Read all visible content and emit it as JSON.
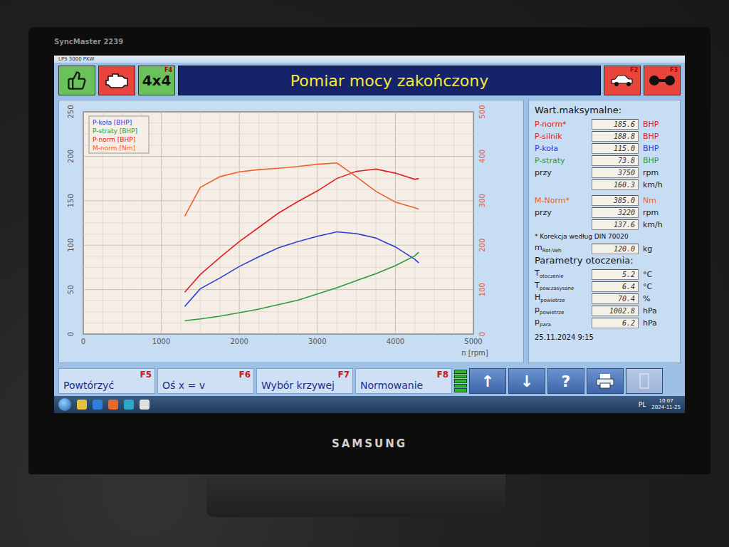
{
  "monitor": {
    "model": "SyncMaster 2239",
    "brand": "SAMSUNG"
  },
  "window": {
    "title": "LPS 3000 PKW"
  },
  "header": {
    "left_buttons": [
      {
        "kind": "thumbs",
        "color": "#6cc25a"
      },
      {
        "kind": "engine",
        "color": "#e8463c"
      },
      {
        "kind": "text",
        "label": "4x4",
        "key": "F4",
        "color": "#6cc25a"
      }
    ],
    "title": "Pomiar mocy zakończony",
    "right_buttons": [
      {
        "kind": "car",
        "key": "F2",
        "color": "#e8463c"
      },
      {
        "kind": "rollers",
        "key": "F3",
        "color": "#e8463c"
      }
    ]
  },
  "chart": {
    "y_left_ticks": [
      "0",
      "50",
      "100",
      "150",
      "200",
      "250"
    ],
    "y_right_ticks": [
      "0",
      "100",
      "200",
      "300",
      "400",
      "500"
    ],
    "x_ticks": [
      "0",
      "1000",
      "2000",
      "3000",
      "4000",
      "5000"
    ],
    "x_label": "n [rpm]",
    "rpm": [
      1300,
      1500,
      1750,
      2000,
      2250,
      2500,
      2750,
      3000,
      3250,
      3500,
      3750,
      4000,
      4250,
      4300
    ],
    "series": [
      {
        "name": "P-koła [BHP]",
        "axis": "left",
        "color": "#2a3fd0",
        "values": [
          31,
          51,
          63,
          76,
          87,
          97,
          104,
          110,
          115,
          113,
          108,
          98,
          84,
          80
        ]
      },
      {
        "name": "P-straty [BHP]",
        "axis": "left",
        "color": "#2a9a3a",
        "values": [
          15,
          17,
          20,
          24,
          28,
          33,
          38,
          45,
          52,
          60,
          68,
          77,
          88,
          92
        ]
      },
      {
        "name": "P-norm [BHP]",
        "axis": "left",
        "color": "#e02020",
        "values": [
          47,
          67,
          86,
          104,
          120,
          136,
          149,
          161,
          175,
          183,
          185.6,
          181,
          174,
          175
        ]
      },
      {
        "name": "M-norm [Nm]",
        "axis": "right",
        "color": "#f0602a",
        "values": [
          265,
          330,
          354,
          365,
          370,
          373,
          377,
          382,
          385,
          354,
          321,
          297,
          284,
          281
        ]
      }
    ]
  },
  "max_values": {
    "title": "Wart.maksymalne:",
    "rows": [
      {
        "label": "P-norm*",
        "value": "185.6",
        "unit": "BHP",
        "color": "#e02020"
      },
      {
        "label": "P-silnik",
        "value": "188.8",
        "unit": "BHP",
        "color": "#e02020"
      },
      {
        "label": "P-koła",
        "value": "115.0",
        "unit": "BHP",
        "color": "#2a3fd0"
      },
      {
        "label": "P-straty",
        "value": "73.8",
        "unit": "BHP",
        "color": "#2a9a3a"
      },
      {
        "label": "przy",
        "value": "3750",
        "unit": "rpm",
        "color": "#1a1a1a"
      },
      {
        "label": "",
        "value": "160.3",
        "unit": "km/h",
        "color": "#1a1a1a"
      }
    ],
    "torque_rows": [
      {
        "label": "M-Norm*",
        "value": "385.0",
        "unit": "Nm",
        "color": "#f0602a"
      },
      {
        "label": "przy",
        "value": "3220",
        "unit": "rpm",
        "color": "#1a1a1a"
      },
      {
        "label": "",
        "value": "137.6",
        "unit": "km/h",
        "color": "#1a1a1a"
      }
    ],
    "note": "* Korekcja według DIN 70020",
    "mass": {
      "label": "m",
      "sub": "Rot-Veh",
      "value": "120.0",
      "unit": "kg"
    }
  },
  "ambient": {
    "title": "Parametry otoczenia:",
    "rows": [
      {
        "label": "T",
        "sub": "otoczenie",
        "value": "5.2",
        "unit": "°C"
      },
      {
        "label": "T",
        "sub": "pow.zasysane",
        "value": "6.4",
        "unit": "°C"
      },
      {
        "label": "H",
        "sub": "powietrze",
        "value": "70.4",
        "unit": "%"
      },
      {
        "label": "p",
        "sub": "powietrze",
        "value": "1002.8",
        "unit": "hPa"
      },
      {
        "label": "p",
        "sub": "para",
        "value": "6.2",
        "unit": "hPa"
      }
    ],
    "date": "25.11.2024  9:15"
  },
  "function_keys": [
    {
      "label": "Powtórzyć",
      "key": "F5"
    },
    {
      "label": "Oś x = v",
      "key": "F6"
    },
    {
      "label": "Wybór krzywej",
      "key": "F7"
    },
    {
      "label": "Normowanie",
      "key": "F8"
    }
  ],
  "signal": {
    "level": 1
  },
  "icon_buttons": [
    {
      "kind": "text",
      "label": "↑",
      "disabled": false
    },
    {
      "kind": "text",
      "label": "↓",
      "disabled": false
    },
    {
      "kind": "text",
      "label": "?",
      "disabled": false
    },
    {
      "kind": "print",
      "disabled": false
    },
    {
      "kind": "blank",
      "disabled": true
    }
  ],
  "taskbar": {
    "language": "PL",
    "time": "10:07",
    "date": "2024-11-25"
  }
}
